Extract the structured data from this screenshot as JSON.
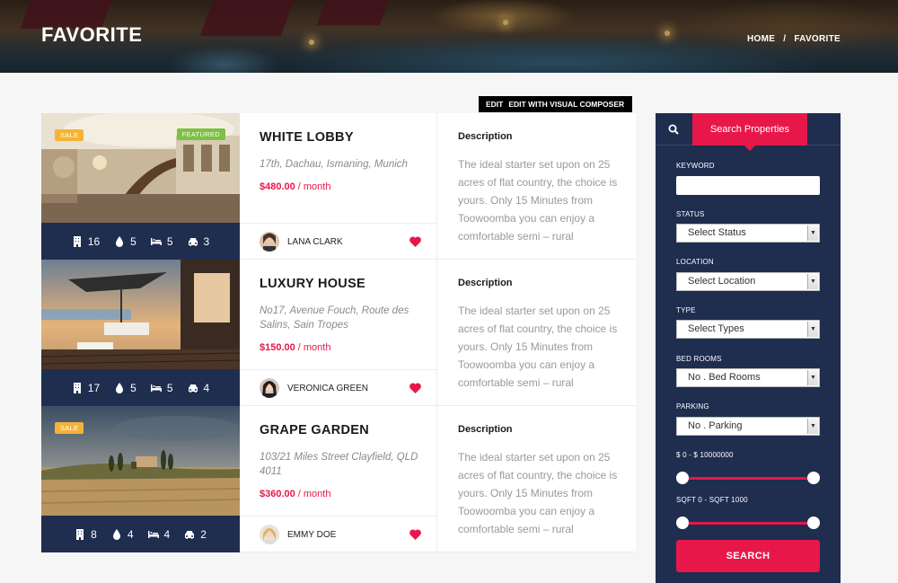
{
  "header": {
    "title": "FAVORITE",
    "breadcrumb": {
      "home": "HOME",
      "separator": "/",
      "current": "FAVORITE"
    }
  },
  "edit_bar": {
    "edit": "EDIT",
    "edit_visual": "EDIT WITH VISUAL COMPOSER"
  },
  "listings": [
    {
      "badges": [
        "SALE",
        "FEATURED"
      ],
      "title": "WHITE LOBBY",
      "address": "17th, Dachau, Ismaning, Munich",
      "price": "$480.00",
      "period": "/ month",
      "stats": {
        "floors": "16",
        "baths": "5",
        "beds": "5",
        "garages": "3"
      },
      "agent": "LANA CLARK",
      "desc_title": "Description",
      "desc": "The ideal starter set upon on 25 acres of flat country, the choice is yours. Only 15 Minutes from Toowoomba you can enjoy a comfortable semi – rural"
    },
    {
      "badges": [],
      "title": "LUXURY HOUSE",
      "address": "No17, Avenue Fouch, Route des Salins, Sain Tropes",
      "price": "$150.00",
      "period": "/ month",
      "stats": {
        "floors": "17",
        "baths": "5",
        "beds": "5",
        "garages": "4"
      },
      "agent": "VERONICA GREEN",
      "desc_title": "Description",
      "desc": "The ideal starter set upon on 25 acres of flat country, the choice is yours. Only 15 Minutes from Toowoomba you can enjoy a comfortable semi – rural"
    },
    {
      "badges": [
        "SALE"
      ],
      "title": "GRAPE GARDEN",
      "address": "103/21 Miles Street Clayfield, QLD 4011",
      "price": "$360.00",
      "period": "/ month",
      "stats": {
        "floors": "8",
        "baths": "4",
        "beds": "4",
        "garages": "2"
      },
      "agent": "EMMY DOE",
      "desc_title": "Description",
      "desc": "The ideal starter set upon on 25 acres of flat country, the choice is yours. Only 15 Minutes from Toowoomba you can enjoy a comfortable semi – rural"
    }
  ],
  "sidebar": {
    "tab": "Search Properties",
    "keyword_label": "KEYWORD",
    "status_label": "STATUS",
    "status_value": "Select Status",
    "location_label": "LOCATION",
    "location_value": "Select Location",
    "type_label": "TYPE",
    "type_value": "Select Types",
    "bedrooms_label": "BED ROOMS",
    "bedrooms_value": "No . Bed Rooms",
    "parking_label": "PARKING",
    "parking_value": "No . Parking",
    "price_range": "$ 0 - $ 10000000",
    "price_range_values": [
      0,
      10000000
    ],
    "sqft_range": "SQFT 0 - SQFT 1000",
    "sqft_range_values": [
      0,
      1000
    ],
    "search_button": "SEARCH"
  },
  "colors": {
    "accent": "#e8174a",
    "navy": "#1f2d4f",
    "sale": "#f5b335",
    "featured": "#7cc142"
  }
}
